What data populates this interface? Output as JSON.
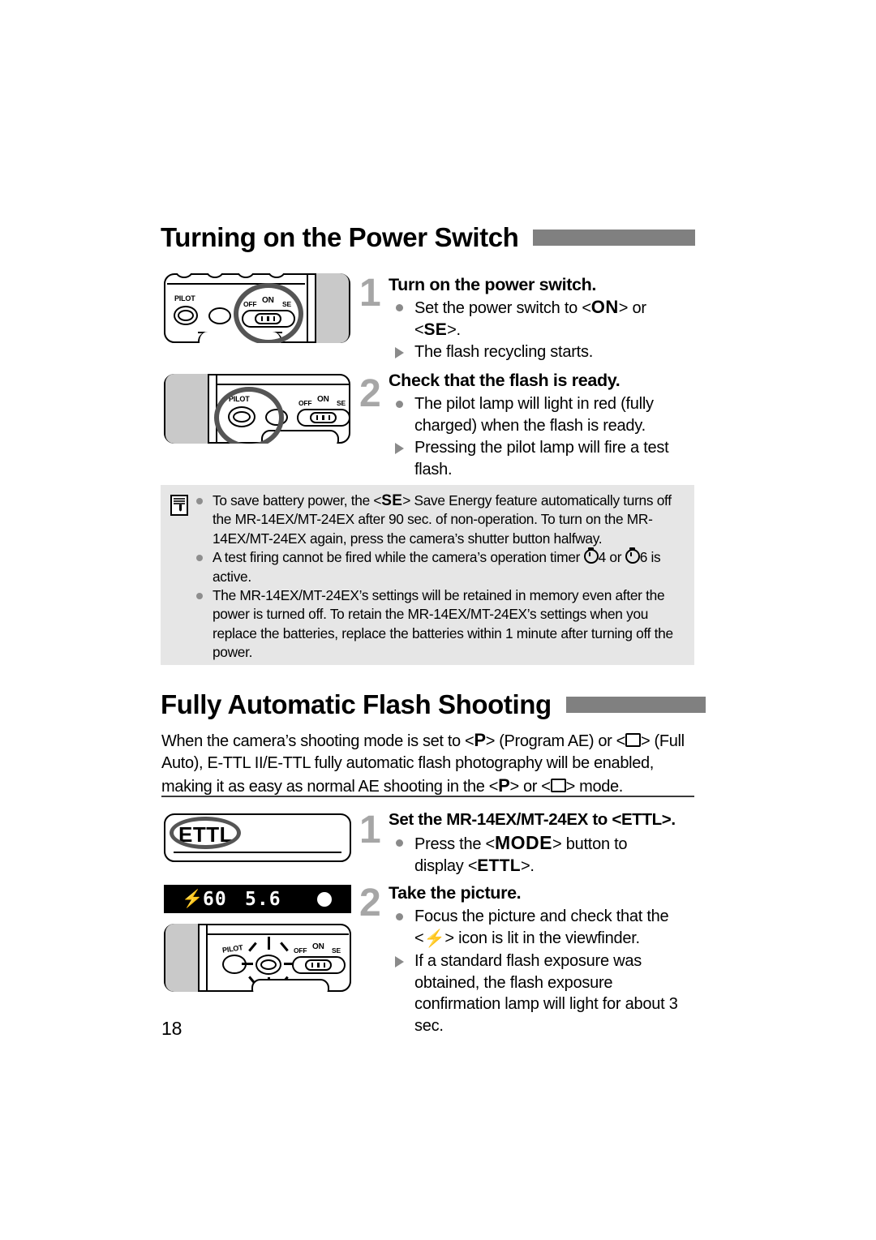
{
  "page": {
    "number": "18"
  },
  "section1": {
    "title": "Turning on the Power Switch",
    "steps": [
      {
        "num": "1",
        "title": "Turn on the power switch.",
        "bullets": [
          {
            "mark": "dot",
            "pre": "Set the power switch to <",
            "icon": "ON",
            "mid": "> or",
            "line2pre": "<",
            "line2icon": "SE",
            "line2post": ">."
          },
          {
            "mark": "tri",
            "text": "The flash recycling starts."
          }
        ]
      },
      {
        "num": "2",
        "title": "Check that the flash is ready.",
        "bullets": [
          {
            "mark": "dot",
            "text": "The pilot lamp will light in red (fully charged) when the flash is ready."
          },
          {
            "mark": "tri",
            "text": "Pressing the pilot lamp will fire a test flash."
          }
        ]
      }
    ],
    "note": {
      "icon": "note-memo-icon",
      "items": [
        {
          "part1": "To save battery power, the <",
          "icon": "SE",
          "part2": "> Save Energy feature automatically turns off the MR-14EX/MT-24EX after 90 sec. of non-operation. To turn on the MR-14EX/MT-24EX again, press the camera’s shutter button halfway."
        },
        {
          "part1": "A test firing cannot be fired while the camera’s operation timer ",
          "timer1": "4",
          "mid": " or ",
          "timer2": "6",
          "part2": " is active."
        },
        {
          "part1": "The MR-14EX/MT-24EX’s settings will be retained in memory even after the power is turned off. To retain the MR-14EX/MT-24EX’s settings when you replace the batteries, replace the batteries within 1 minute after turning off the power."
        }
      ]
    }
  },
  "section2": {
    "title": "Fully Automatic Flash Shooting",
    "intro": {
      "p1": "When the camera’s shooting mode is set to <",
      "icon1": "P",
      "p2": "> (Program AE) or <",
      "icon2": "full-auto-box",
      "p3": "> (Full Auto), E-TTL II/E-TTL fully automatic flash photography will be enabled, making it as easy as normal AE shooting in the <",
      "icon3": "P",
      "p4": "> or <",
      "icon4": "full-auto-box",
      "p5": "> mode."
    },
    "steps": [
      {
        "num": "1",
        "title": "Set the MR-14EX/MT-24EX to <ETTL>.",
        "bullets": [
          {
            "mark": "dot",
            "pre": "Press the <",
            "icon": "MODE",
            "mid": "> button to",
            "line2pre": "display <",
            "line2icon": "ETTL",
            "line2post": ">."
          }
        ]
      },
      {
        "num": "2",
        "title": "Take the picture.",
        "bullets": [
          {
            "mark": "dot",
            "pre": "Focus the picture and check that the",
            "line2pre": "<",
            "line2icon": "flash-bolt",
            "line2post": "> icon is lit in the viewfinder."
          },
          {
            "mark": "tri",
            "text": "If a standard flash exposure was obtained, the flash exposure confirmation lamp will light for about 3 sec."
          }
        ]
      }
    ]
  },
  "illustrations": {
    "fig1": {
      "name": "power-switch-closeup",
      "pilot_label": "PILOT",
      "switch_label_off": "OFF",
      "switch_label_on": "ON",
      "switch_label_se": "SE"
    },
    "fig2": {
      "name": "pilot-lamp-closeup",
      "pilot_label": "PILOT",
      "switch_label_off": "OFF",
      "switch_label_on": "ON",
      "switch_label_se": "SE"
    },
    "fig3": {
      "name": "ettl-lcd-panel",
      "display_text": "ETTL"
    },
    "fig4": {
      "name": "viewfinder-display",
      "flash_icon": "flash-bolt",
      "shutter_speed": "60",
      "aperture": "5.6",
      "confirm_lamp": "●"
    },
    "fig5": {
      "name": "flash-confirmation-lamp-closeup",
      "pilot_label": "PILOT",
      "switch_label_off": "OFF",
      "switch_label_on": "ON",
      "switch_label_se": "SE"
    }
  },
  "colors": {
    "heading_bar": "#808080",
    "note_background": "#e6e6e6",
    "step_number": "#a6a6a6",
    "bullet_marker": "#8a8a8a",
    "body_grey": "#c9c9c9"
  }
}
